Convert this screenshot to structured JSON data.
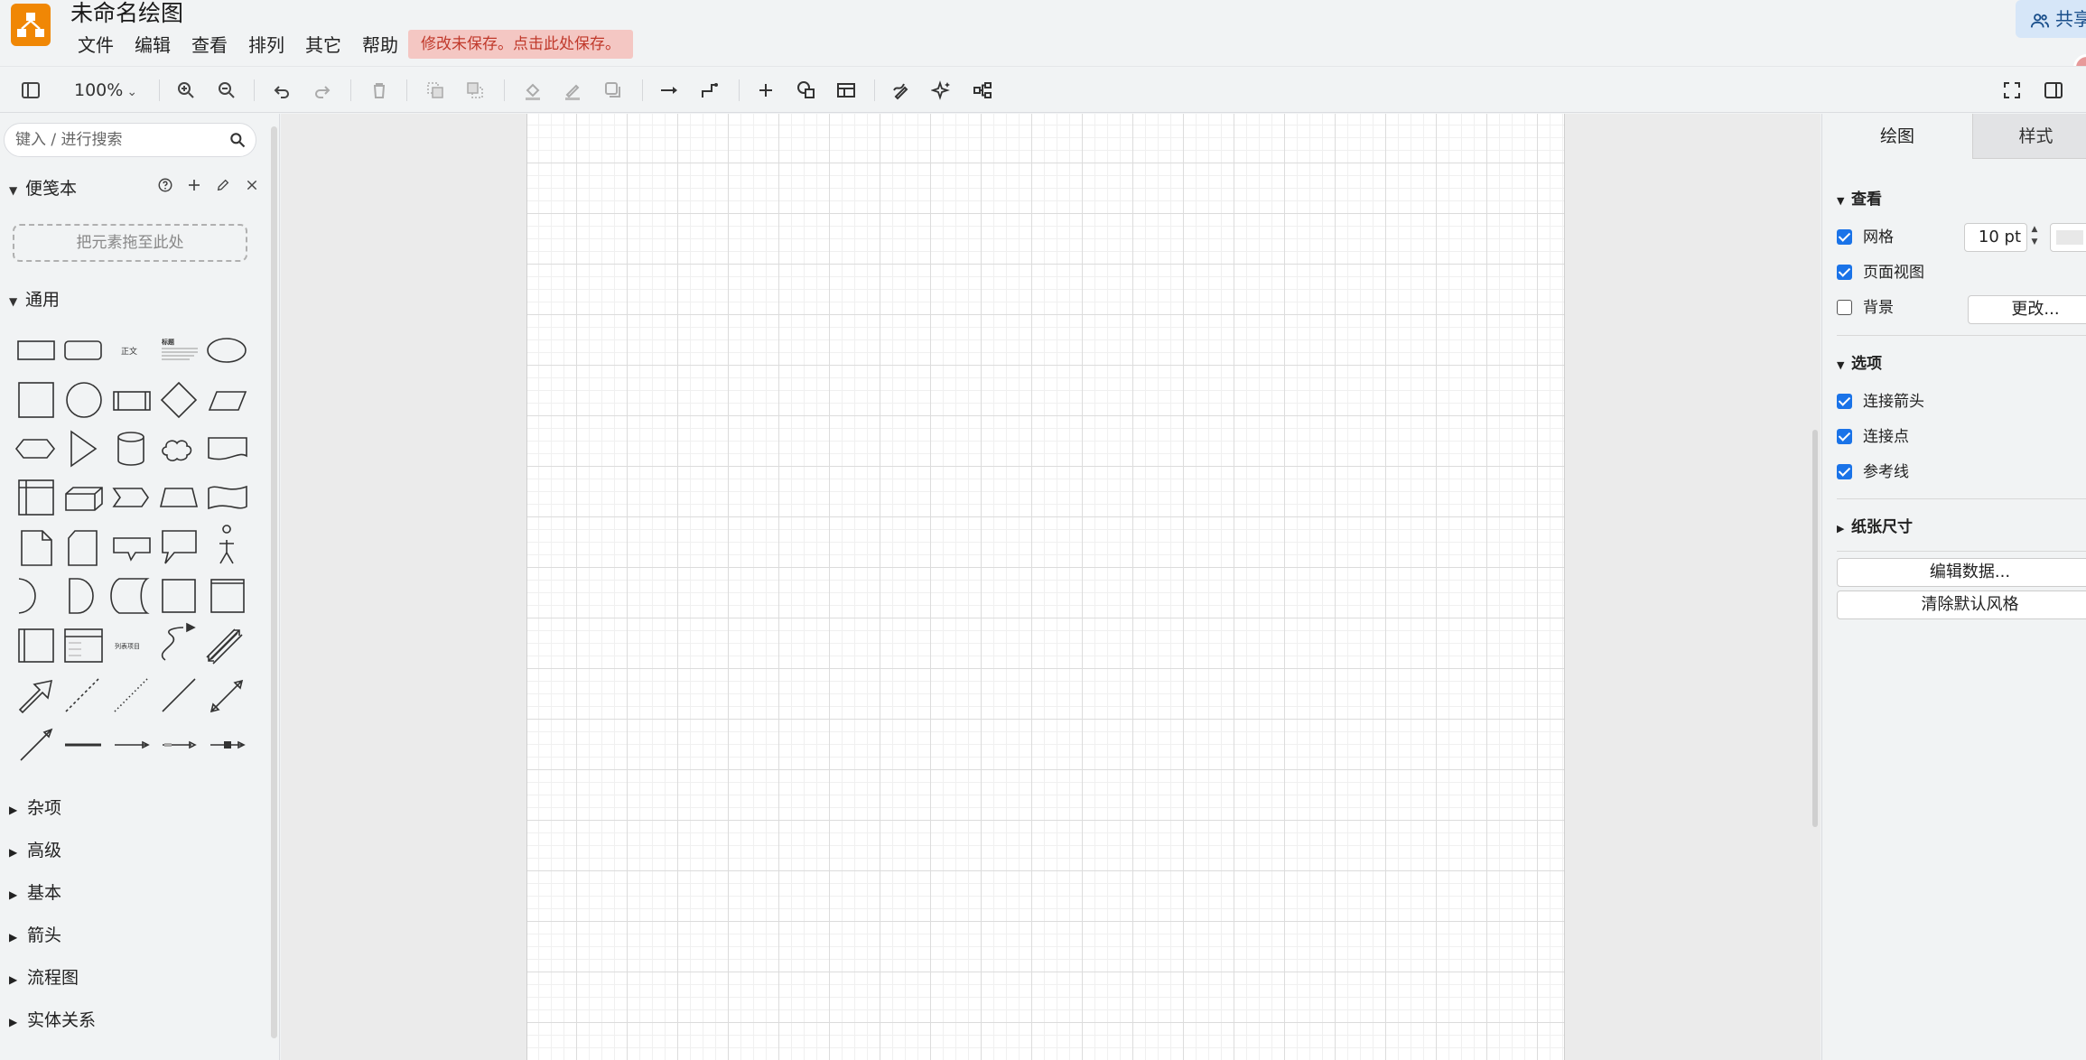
{
  "app": {
    "title": "未命名绘图",
    "unsaved_notice": "修改未保存。点击此处保存。",
    "share_label": "共享"
  },
  "menu": {
    "items": [
      "文件",
      "编辑",
      "查看",
      "排列",
      "其它",
      "帮助"
    ]
  },
  "toolbar": {
    "zoom": "100%",
    "icons": [
      "sidebar-toggle-icon",
      "zoom-in-icon",
      "zoom-out-icon",
      "undo-icon",
      "redo-icon",
      "delete-icon",
      "to-front-icon",
      "to-back-icon",
      "fill-color-icon",
      "line-color-icon",
      "shadow-icon",
      "connection-icon",
      "waypoints-icon",
      "insert-icon",
      "shapes-icon",
      "table-icon",
      "freehand-icon",
      "magic-icon",
      "layout-icon",
      "fullscreen-icon",
      "format-panel-icon"
    ]
  },
  "sidebar": {
    "search_placeholder": "键入 / 进行搜索",
    "notepad_title": "便笺本",
    "dropzone_text": "把元素拖至此处",
    "general_title": "通用",
    "shape_text_label": "正文",
    "shape_heading_label": "标题",
    "shape_list_label": "列表项目",
    "collapsed_sections": [
      "杂项",
      "高级",
      "基本",
      "箭头",
      "流程图",
      "实体关系"
    ]
  },
  "panel": {
    "tabs": [
      "绘图",
      "样式"
    ],
    "view_section": "查看",
    "grid_label": "网格",
    "grid_size": "10 pt",
    "page_view_label": "页面视图",
    "background_label": "背景",
    "change_button": "更改...",
    "options_section": "选项",
    "connection_arrows_label": "连接箭头",
    "connection_points_label": "连接点",
    "guides_label": "参考线",
    "paper_size_section": "纸张尺寸",
    "edit_data_button": "编辑数据...",
    "clear_style_button": "清除默认风格",
    "checkbox_states": {
      "grid": true,
      "page_view": true,
      "background": false,
      "connection_arrows": true,
      "connection_points": true,
      "guides": true
    }
  },
  "colors": {
    "accent": "#1a73e8",
    "logo": "#f08705",
    "unsaved_bg": "#f4c7c3",
    "unsaved_text": "#c0392b"
  }
}
